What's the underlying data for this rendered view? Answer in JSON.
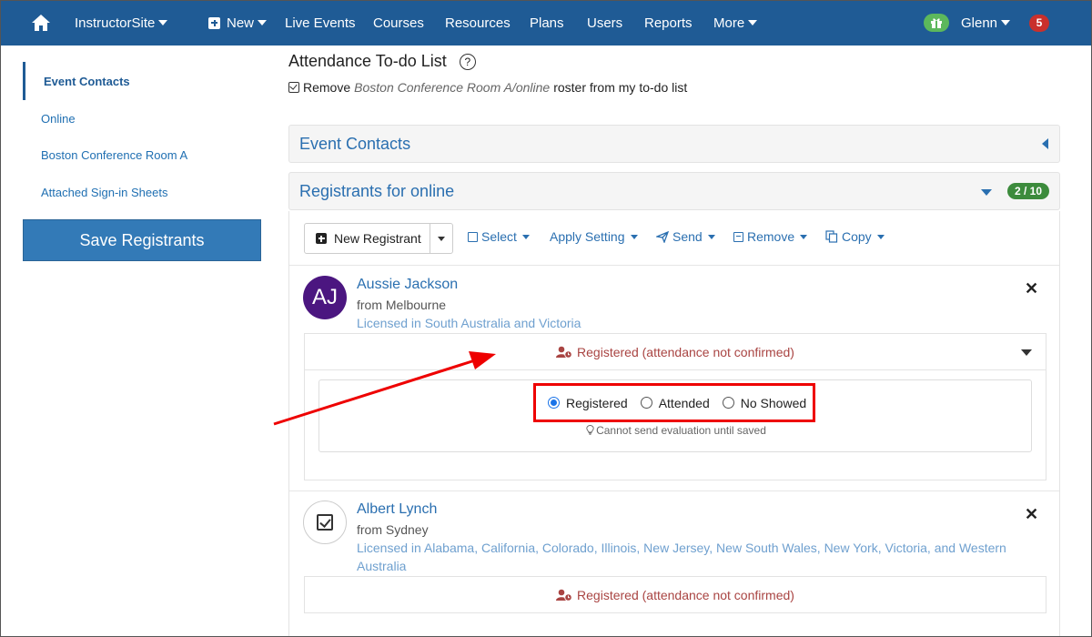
{
  "nav": {
    "brand": "InstructorSite",
    "new_label": "New",
    "items": [
      "Live Events",
      "Courses",
      "Resources",
      "Plans",
      "Users",
      "Reports"
    ],
    "more_label": "More",
    "user": "Glenn",
    "notif_count": "5"
  },
  "sidebar": {
    "items": [
      {
        "label": "Event Contacts",
        "active": true
      },
      {
        "label": "Online"
      },
      {
        "label": "Boston Conference Room A"
      },
      {
        "label": "Attached Sign-in Sheets"
      }
    ],
    "save_label": "Save Registrants"
  },
  "todo": {
    "title": "Attendance To-do List",
    "help": "?",
    "prefix": "Remove",
    "roster": "Boston Conference Room A/online",
    "suffix": "roster from my to-do list"
  },
  "panels": {
    "event_contacts": "Event Contacts",
    "registrants_title": "Registrants for online",
    "registrant_count": "2 / 10"
  },
  "toolbar": {
    "new_registrant": "New Registrant",
    "select": "Select",
    "apply_setting": "Apply Setting",
    "send": "Send",
    "remove": "Remove",
    "copy": "Copy"
  },
  "registrants": [
    {
      "initials": "AJ",
      "name": "Aussie Jackson",
      "from": "from Melbourne",
      "licensed": "Licensed in South Australia and Victoria",
      "status": "Registered (attendance not confirmed)",
      "options": [
        "Registered",
        "Attended",
        "No Showed"
      ],
      "selected": "Registered",
      "hint": "Cannot send evaluation until saved"
    },
    {
      "name": "Albert Lynch",
      "from": "from Sydney",
      "licensed": "Licensed in Alabama, California, Colorado, Illinois, New Jersey, New South Wales, New York, Victoria, and Western Australia",
      "status": "Registered (attendance not confirmed)"
    }
  ],
  "colors": {
    "nav_bg": "#1f5b95",
    "link": "#2a6fb0",
    "status_red": "#a94442",
    "annotation": "#e00000",
    "count_badge": "#3c8b3c"
  }
}
